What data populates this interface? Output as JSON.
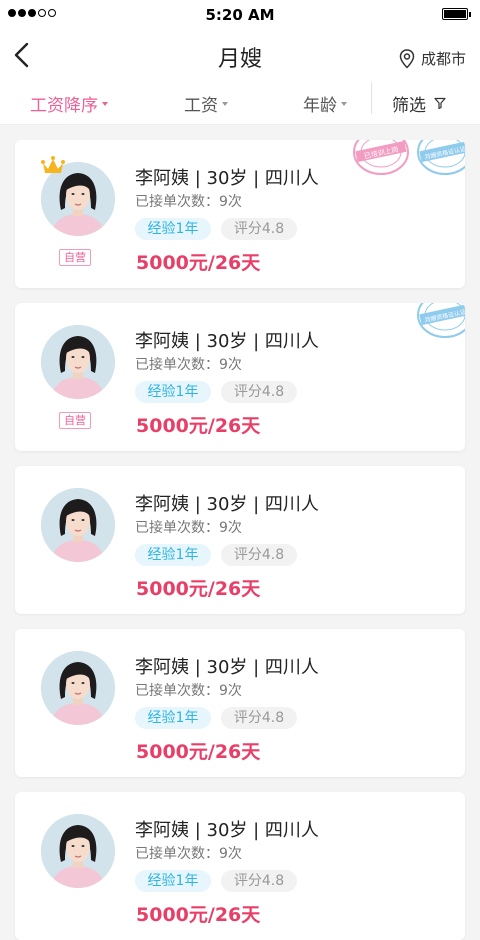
{
  "status_bar": {
    "time": "5:20 AM"
  },
  "header": {
    "title": "月嫂",
    "location": "成都市"
  },
  "filters": [
    {
      "label": "工资降序",
      "active": true
    },
    {
      "label": "工资",
      "active": false
    },
    {
      "label": "年龄",
      "active": false
    },
    {
      "label": "筛选"
    }
  ],
  "stamps": {
    "pink": "已培训上岗",
    "blue": "月嫂资格证认证"
  },
  "self_label": "自营",
  "nannies": [
    {
      "name": "李阿姨 | 30岁 | 四川人",
      "orders": "已接单次数：9次",
      "experience": "经验1年",
      "rating": "评分4.8",
      "price": "5000元/26天"
    },
    {
      "name": "李阿姨 | 30岁 | 四川人",
      "orders": "已接单次数：9次",
      "experience": "经验1年",
      "rating": "评分4.8",
      "price": "5000元/26天"
    },
    {
      "name": "李阿姨 | 30岁 | 四川人",
      "orders": "已接单次数：9次",
      "experience": "经验1年",
      "rating": "评分4.8",
      "price": "5000元/26天"
    },
    {
      "name": "李阿姨 | 30岁 | 四川人",
      "orders": "已接单次数：9次",
      "experience": "经验1年",
      "rating": "评分4.8",
      "price": "5000元/26天"
    },
    {
      "name": "李阿姨 | 30岁 | 四川人",
      "orders": "已接单次数：9次",
      "experience": "经验1年",
      "rating": "评分4.8",
      "price": "5000元/26天"
    }
  ],
  "colors": {
    "accent": "#ee5f95",
    "price": "#e83f68",
    "experience_tag": "#2fb4e3"
  }
}
